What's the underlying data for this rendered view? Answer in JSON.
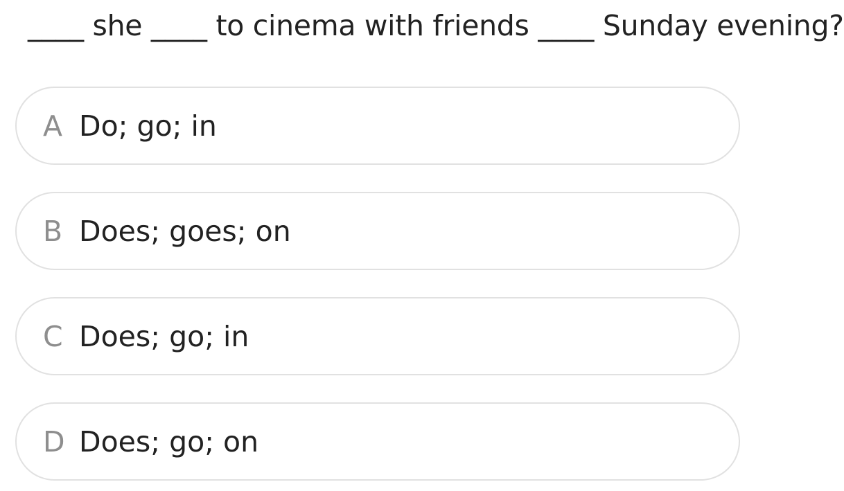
{
  "question": {
    "text": "____ she ____ to cinema with friends ____ Sunday evening?"
  },
  "options": [
    {
      "letter": "A",
      "text": "Do; go; in"
    },
    {
      "letter": "B",
      "text": "Does; goes; on"
    },
    {
      "letter": "C",
      "text": "Does; go; in"
    },
    {
      "letter": "D",
      "text": "Does; go; on"
    }
  ]
}
